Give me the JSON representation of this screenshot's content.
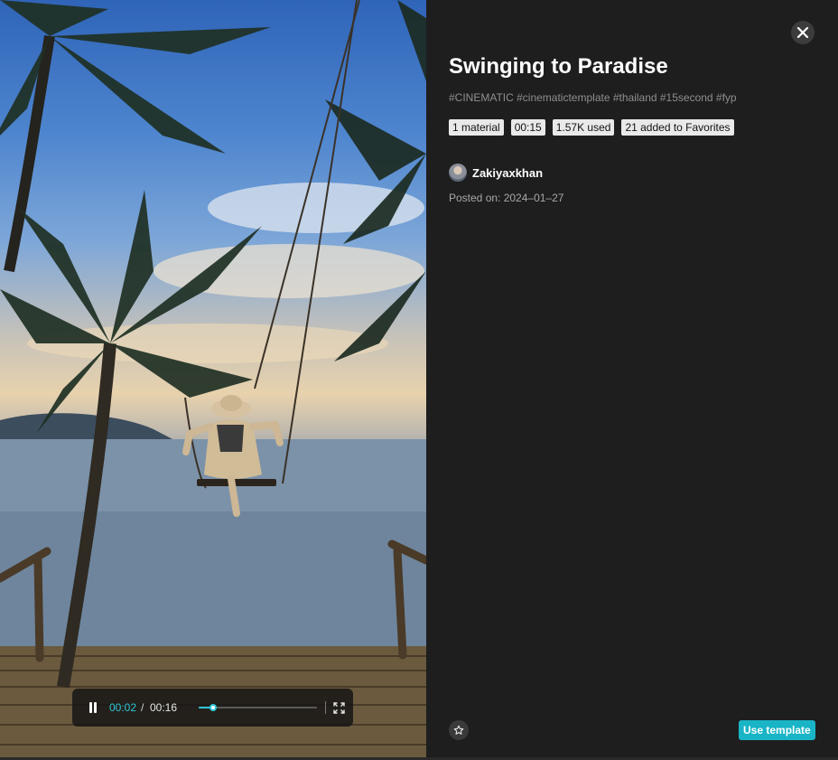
{
  "player": {
    "current_time": "00:02",
    "separator": "/",
    "total_time": "00:16",
    "progress_fraction": 0.125,
    "pause_icon": "pause-icon",
    "fullscreen_icon": "fullscreen-icon"
  },
  "details": {
    "title": "Swinging to Paradise",
    "tags": "#CINEMATIC #cinematictemplate #thailand #15second #fyp",
    "chips": [
      "1 material",
      "00:15",
      "1.57K used",
      "21 added to Favorites"
    ],
    "author_name": "Zakiyaxkhan",
    "posted": "Posted on: 2024–01–27"
  },
  "actions": {
    "close_icon": "close-icon",
    "favorite_icon": "star-icon",
    "use_template_label": "Use template"
  },
  "colors": {
    "accent": "#19b5c7",
    "progress": "#2fc7d8",
    "panel_background": "#1e1e1e"
  }
}
